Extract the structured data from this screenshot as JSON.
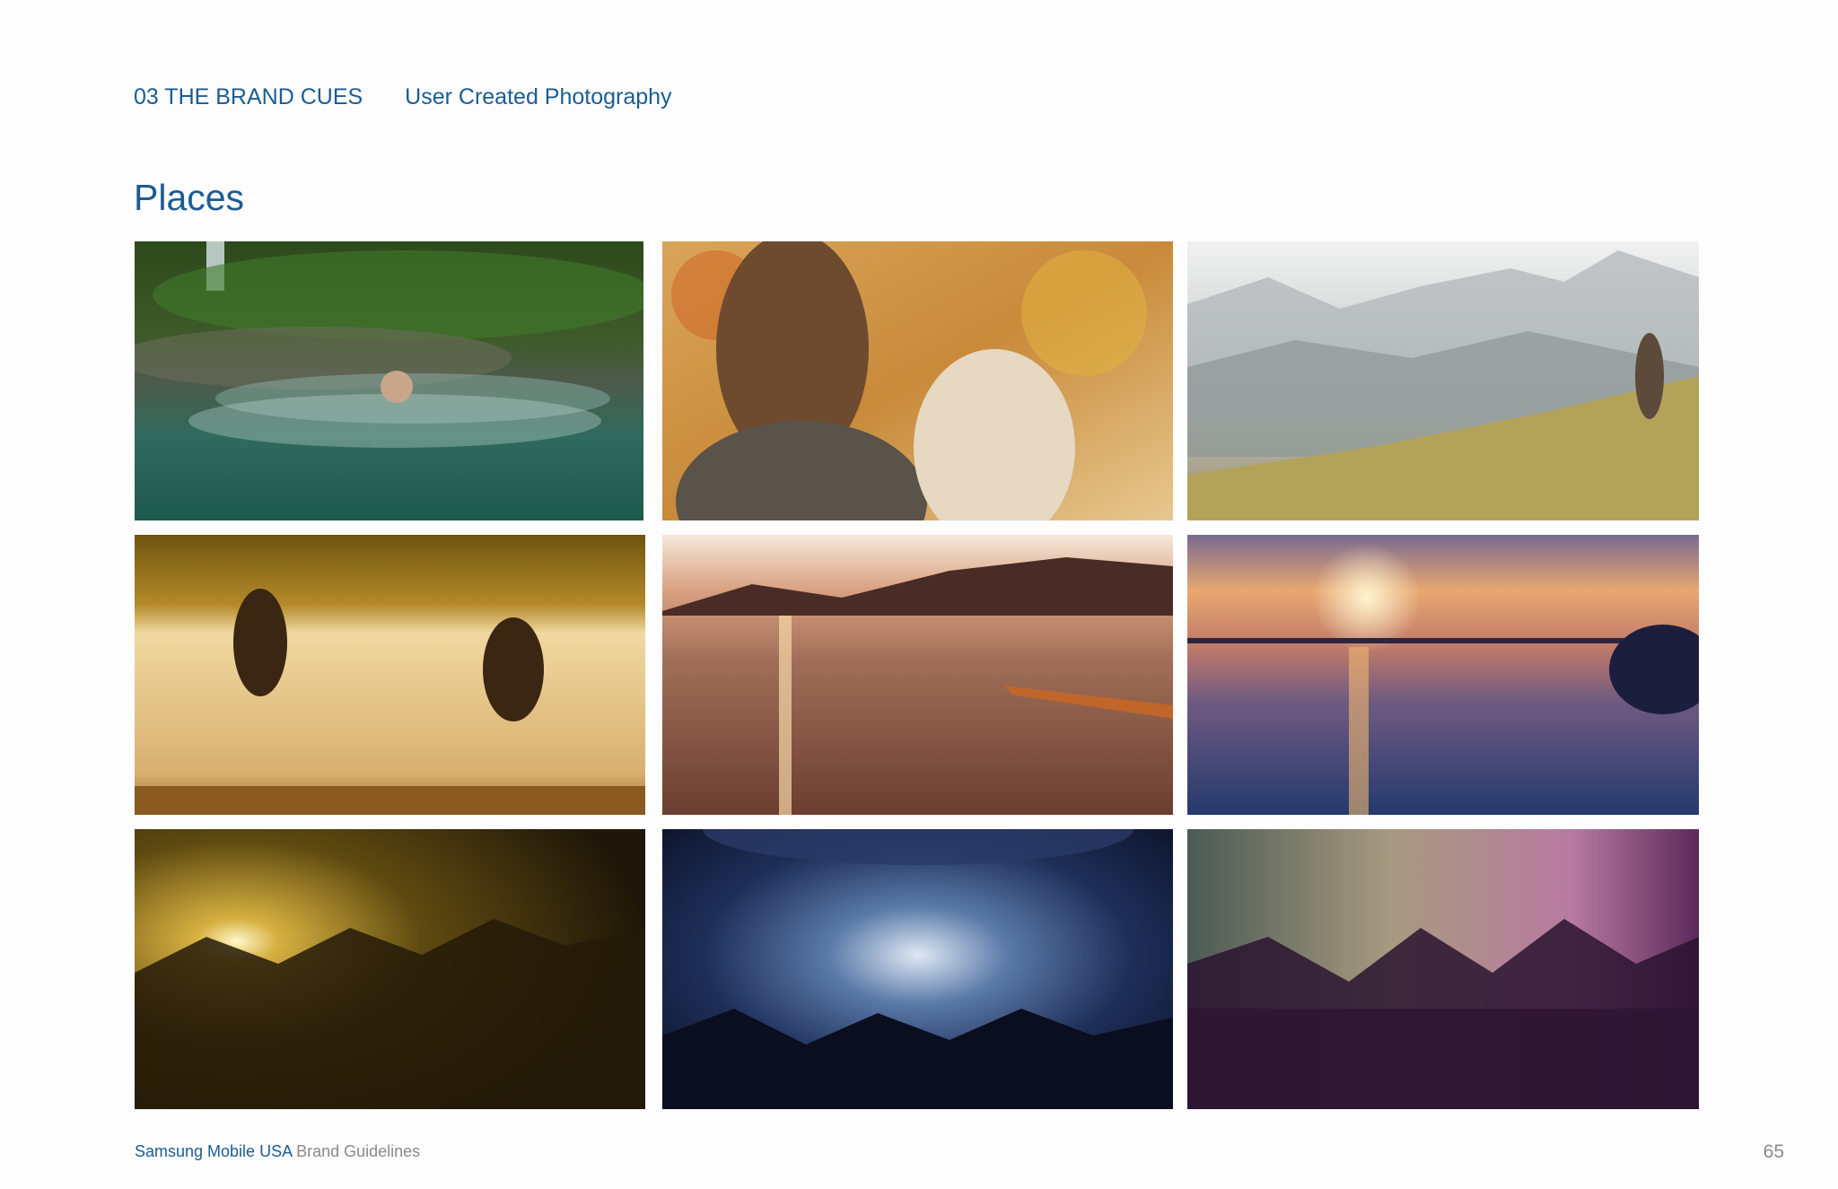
{
  "header": {
    "section": "03 THE BRAND CUES",
    "topic": "User Created Photography"
  },
  "title": "Places",
  "footer": {
    "brand": "Samsung Mobile USA",
    "sub": " Brand Guidelines",
    "page": "65"
  },
  "colors": {
    "accent": "#1b5c93",
    "muted": "#8a8a8a",
    "background": "#fdfdfd"
  }
}
